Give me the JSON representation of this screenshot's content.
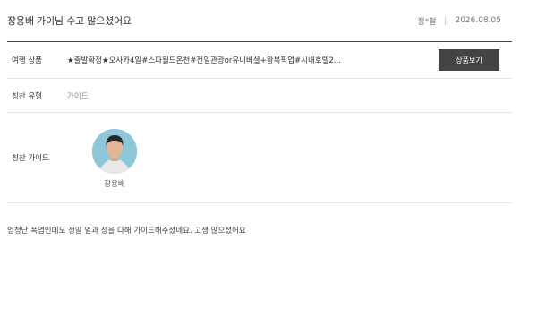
{
  "review": {
    "title": "장용배 가이님 수고 많으셨어요",
    "author": "정*철",
    "date": "2026.08.05"
  },
  "product": {
    "label": "여행 상품",
    "name": "★출발확정★오사카4일#스파월드온천#전일관광or유니버셜+왕복픽업#시내호텔2...",
    "button_label": "상품보기"
  },
  "praise_type": {
    "label": "칭찬 유형",
    "value": "가이드"
  },
  "praise_guide": {
    "label": "칭찬 가이드",
    "name": "장용배",
    "avatar_color": "#8ec7d8"
  },
  "comment": {
    "text": "엄청난 폭염인데도 정말 열과 성을 다해 가이드해주셨네요. 고생 많으셨어요"
  }
}
